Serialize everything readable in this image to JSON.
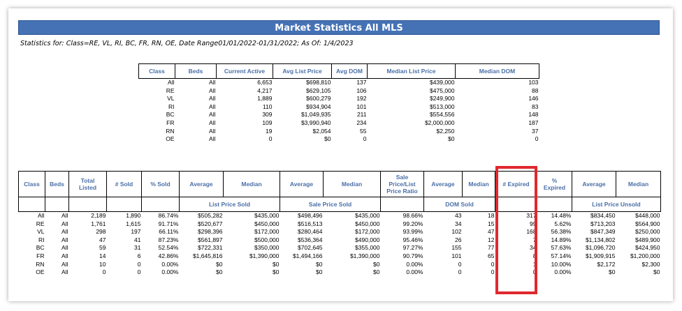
{
  "title": "Market Statistics All MLS",
  "stats_line": "Statistics for: Class=RE, VL, RI, BC, FR, RN, OE, Date Range01/01/2022-01/31/2022; As Of: 1/4/2023",
  "summary": {
    "headers": [
      "Class",
      "Beds",
      "Current Active",
      "Avg List Price",
      "Avg DOM",
      "Median List Price",
      "Median DOM"
    ],
    "rows": [
      [
        "All",
        "All",
        "6,653",
        "$698,810",
        "137",
        "$439,000",
        "103"
      ],
      [
        "RE",
        "All",
        "4,217",
        "$629,105",
        "106",
        "$475,000",
        "88"
      ],
      [
        "VL",
        "All",
        "1,889",
        "$600,279",
        "192",
        "$249,900",
        "146"
      ],
      [
        "RI",
        "All",
        "110",
        "$934,904",
        "101",
        "$513,000",
        "83"
      ],
      [
        "BC",
        "All",
        "309",
        "$1,049,935",
        "211",
        "$554,556",
        "148"
      ],
      [
        "FR",
        "All",
        "109",
        "$3,990,940",
        "234",
        "$2,000,000",
        "187"
      ],
      [
        "RN",
        "All",
        "19",
        "$2,054",
        "55",
        "$2,250",
        "37"
      ],
      [
        "OE",
        "All",
        "0",
        "$0",
        "0",
        "$0",
        "0"
      ]
    ]
  },
  "detail": {
    "headers": [
      "Class",
      "Beds",
      "Total Listed",
      "# Sold",
      "% Sold",
      "Average",
      "Median",
      "Average",
      "Median",
      "Sale Price/List Price Ratio",
      "Average",
      "Median",
      "# Expired",
      "% Expired",
      "Average",
      "Median"
    ],
    "groups": [
      "List Price Sold",
      "Sale Price Sold",
      "DOM Sold",
      "List Price Unsold"
    ],
    "rows": [
      [
        "All",
        "All",
        "2,189",
        "1,890",
        "86.74%",
        "$505,282",
        "$435,000",
        "$498,496",
        "$435,000",
        "98.66%",
        "43",
        "18",
        "317",
        "14.48%",
        "$834,450",
        "$448,000"
      ],
      [
        "RE",
        "All",
        "1,761",
        "1,615",
        "91.71%",
        "$520,677",
        "$450,000",
        "$516,513",
        "$450,000",
        "99.20%",
        "34",
        "15",
        "99",
        "5.62%",
        "$713,203",
        "$564,900"
      ],
      [
        "VL",
        "All",
        "298",
        "197",
        "66.11%",
        "$298,396",
        "$172,000",
        "$280,464",
        "$172,000",
        "93.99%",
        "102",
        "47",
        "168",
        "56.38%",
        "$847,349",
        "$250,000"
      ],
      [
        "RI",
        "All",
        "47",
        "41",
        "87.23%",
        "$561,897",
        "$500,000",
        "$536,364",
        "$490,000",
        "95.46%",
        "26",
        "12",
        "7",
        "14.89%",
        "$1,134,802",
        "$489,900"
      ],
      [
        "BC",
        "All",
        "59",
        "31",
        "52.54%",
        "$722,331",
        "$350,000",
        "$702,645",
        "$355,000",
        "97.27%",
        "155",
        "77",
        "34",
        "57.63%",
        "$1,096,720",
        "$424,950"
      ],
      [
        "FR",
        "All",
        "14",
        "6",
        "42.86%",
        "$1,645,816",
        "$1,390,000",
        "$1,494,166",
        "$1,390,000",
        "90.79%",
        "101",
        "65",
        "8",
        "57.14%",
        "$1,909,915",
        "$1,200,000"
      ],
      [
        "RN",
        "All",
        "10",
        "0",
        "0.00%",
        "$0",
        "$0",
        "$0",
        "$0",
        "0.00%",
        "0",
        "0",
        "1",
        "10.00%",
        "$2,172",
        "$2,300"
      ],
      [
        "OE",
        "All",
        "0",
        "0",
        "0.00%",
        "$0",
        "$0",
        "$0",
        "$0",
        "0.00%",
        "0",
        "0",
        "0",
        "0.00%",
        "$0",
        "$0"
      ]
    ]
  },
  "colors": {
    "title_bar": "#4572b5",
    "header_text": "#4a6fa8",
    "highlight": "#e0282e"
  }
}
